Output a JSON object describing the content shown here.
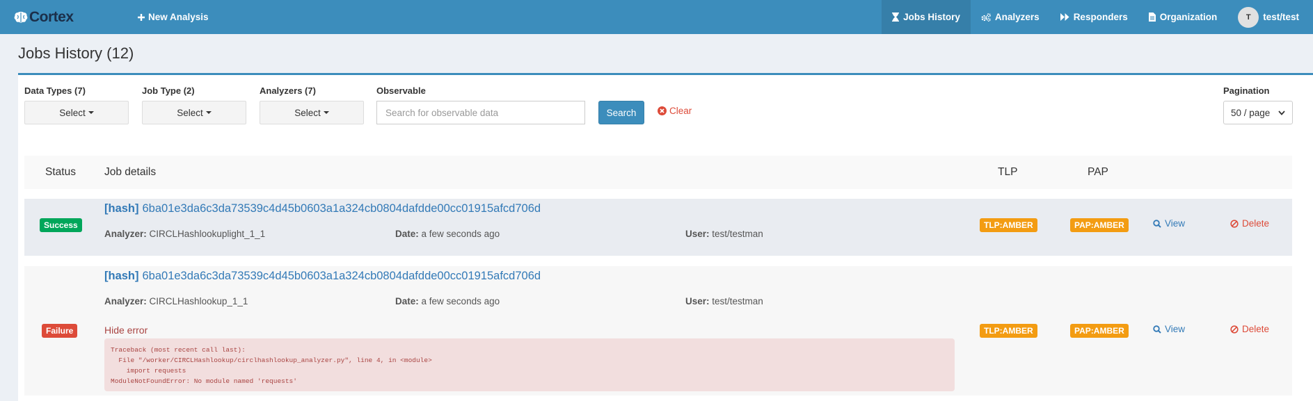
{
  "brand": {
    "name": "Cortex"
  },
  "nav": {
    "new_analysis": "New Analysis",
    "items": [
      {
        "label": "Jobs History",
        "icon": "hourglass-icon",
        "active": true
      },
      {
        "label": "Analyzers",
        "icon": "cogs-icon"
      },
      {
        "label": "Responders",
        "icon": "fast-forward-icon"
      },
      {
        "label": "Organization",
        "icon": "document-icon"
      }
    ],
    "user": {
      "initial": "T",
      "name": "test/test"
    }
  },
  "page": {
    "title": "Jobs History (12)"
  },
  "filters": {
    "data_types": {
      "label": "Data Types (7)",
      "value": "Select"
    },
    "job_type": {
      "label": "Job Type (2)",
      "value": "Select"
    },
    "analyzers": {
      "label": "Analyzers (7)",
      "value": "Select"
    },
    "observable": {
      "label": "Observable",
      "placeholder": "Search for observable data"
    },
    "search_label": "Search",
    "clear_label": "Clear",
    "pagination": {
      "label": "Pagination",
      "value": "50 / page"
    }
  },
  "table": {
    "headers": {
      "status": "Status",
      "details": "Job details",
      "tlp": "TLP",
      "pap": "PAP"
    },
    "rows": [
      {
        "status": "Success",
        "type": "[hash]",
        "hash": "6ba01e3da6c3da73539c4d45b0603a1a324cb0804dafdde00cc01915afcd706d",
        "analyzer_label": "Analyzer:",
        "analyzer": "CIRCLHashlookuplight_1_1",
        "date_label": "Date:",
        "date": "a few seconds ago",
        "user_label": "User:",
        "user": "test/testman",
        "tlp": "TLP:AMBER",
        "pap": "PAP:AMBER",
        "view": "View",
        "delete": "Delete"
      },
      {
        "status": "Failure",
        "type": "[hash]",
        "hash": "6ba01e3da6c3da73539c4d45b0603a1a324cb0804dafdde00cc01915afcd706d",
        "analyzer_label": "Analyzer:",
        "analyzer": "CIRCLHashlookup_1_1",
        "date_label": "Date:",
        "date": "a few seconds ago",
        "user_label": "User:",
        "user": "test/testman",
        "tlp": "TLP:AMBER",
        "pap": "PAP:AMBER",
        "view": "View",
        "delete": "Delete",
        "hide_error": "Hide error",
        "error": "Traceback (most recent call last):\n  File \"/worker/CIRCLHashlookup/circlhashlookup_analyzer.py\", line 4, in <module>\n    import requests\nModuleNotFoundError: No module named 'requests'"
      }
    ]
  },
  "colors": {
    "navbar": "#3c8dbc",
    "success": "#00a65a",
    "failure": "#dd4b39",
    "amber": "#f39c12",
    "link": "#337ab7"
  }
}
